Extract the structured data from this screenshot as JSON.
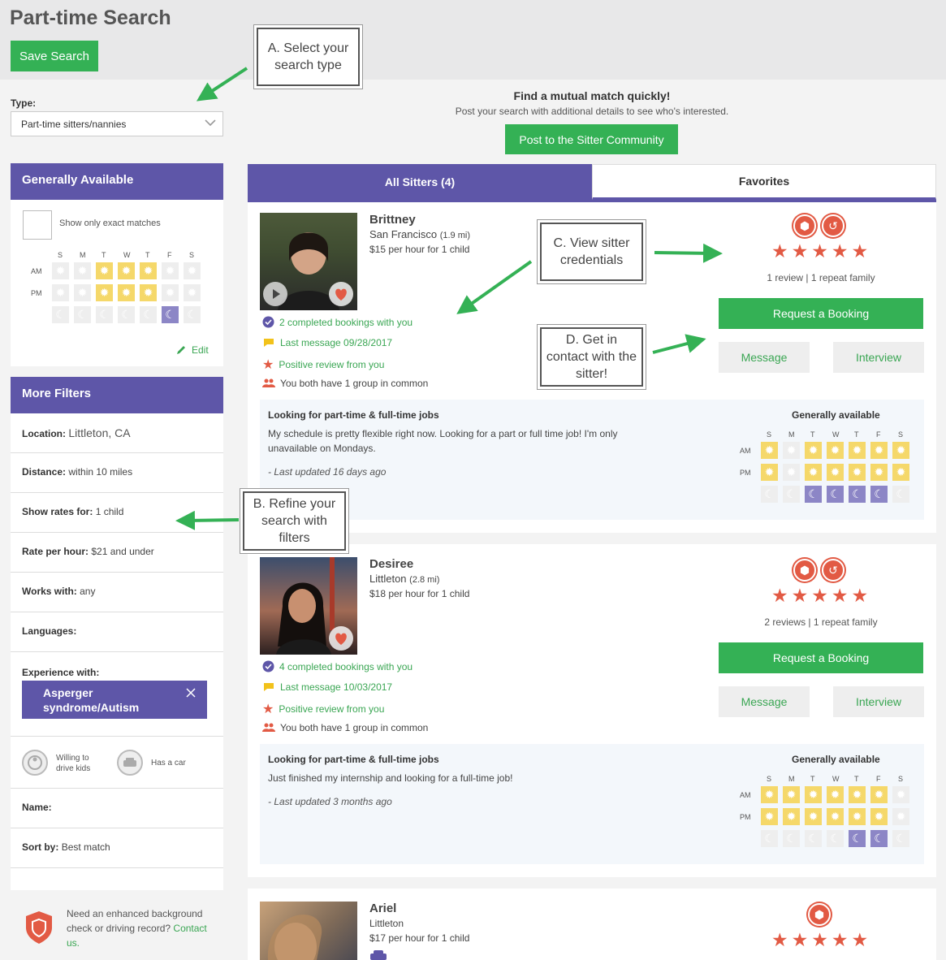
{
  "page": {
    "title": "Part-time Search",
    "save_label": "Save Search"
  },
  "type_filter": {
    "label": "Type:",
    "value": "Part-time sitters/nannies"
  },
  "promo": {
    "title": "Find a mutual match quickly!",
    "subtitle": "Post your search with additional details to see who's interested.",
    "button": "Post to the Sitter Community"
  },
  "availability": {
    "heading": "Generally Available",
    "exact_label": "Show only exact matches",
    "days": [
      "S",
      "M",
      "T",
      "W",
      "T",
      "F",
      "S"
    ],
    "am_label": "AM",
    "pm_label": "PM",
    "edit_label": "Edit"
  },
  "filters": {
    "heading": "More Filters",
    "location": {
      "label": "Location:",
      "value": "Littleton, CA"
    },
    "distance": {
      "label": "Distance:",
      "value": "within 10 miles"
    },
    "rates": {
      "label": "Show rates for:",
      "value": "1 child"
    },
    "rate_hour": {
      "label": "Rate per hour:",
      "value": "$21 and under"
    },
    "works_with": {
      "label": "Works with:",
      "value": "any"
    },
    "languages": {
      "label": "Languages:"
    },
    "experience": {
      "label": "Experience with:",
      "chip": "Asperger syndrome/Autism"
    },
    "drive_kids": "Willing to drive kids",
    "has_car": "Has a car",
    "name": {
      "label": "Name:"
    },
    "sort": {
      "label": "Sort by:",
      "value": "Best match"
    }
  },
  "bg_check": {
    "text": "Need an enhanced background check or driving record?",
    "link": "Contact us."
  },
  "tabs": {
    "all": "All Sitters (4)",
    "favorites": "Favorites"
  },
  "sitters": [
    {
      "name": "Brittney",
      "location": "San Francisco",
      "distance": "(1.9 mi)",
      "rate": "$15 per hour for 1 child",
      "bookings": "2 completed bookings with you",
      "last_message": "Last message 09/28/2017",
      "review": "Positive review from you",
      "groups": "You both have 1 group in common",
      "reviews": "1 review | 1 repeat family",
      "desc_title": "Looking for part-time & full-time jobs",
      "desc": "My schedule is pretty flexible right now. Looking for a part or full time job! I'm only unavailable on Mondays.",
      "updated": "- Last updated 16 days ago",
      "avail_title": "Generally available"
    },
    {
      "name": "Desiree",
      "location": "Littleton",
      "distance": "(2.8 mi)",
      "rate": "$18 per hour for 1 child",
      "bookings": "4 completed bookings with you",
      "last_message": "Last message 10/03/2017",
      "review": "Positive review from you",
      "groups": "You both have 1 group in common",
      "reviews": "2 reviews | 1 repeat family",
      "desc_title": "Looking for part-time & full-time jobs",
      "desc": "Just finished my internship and looking for a full-time job!",
      "updated": "- Last updated 3 months ago",
      "avail_title": "Generally available"
    },
    {
      "name": "Ariel",
      "location": "Littleton",
      "rate": "$17 per hour for 1 child"
    }
  ],
  "actions": {
    "request": "Request a Booking",
    "message": "Message",
    "interview": "Interview"
  },
  "stars": "★★★★★",
  "callouts": {
    "a": "A. Select your search type",
    "b": "B. Refine your search with filters",
    "c": "C. View sitter credentials",
    "d": "D. Get in contact with the sitter!"
  },
  "colors": {
    "brand_purple": "#5e56a8",
    "action_green": "#34b155",
    "badge_red": "#e25a44",
    "sun": "#f5d86a"
  }
}
